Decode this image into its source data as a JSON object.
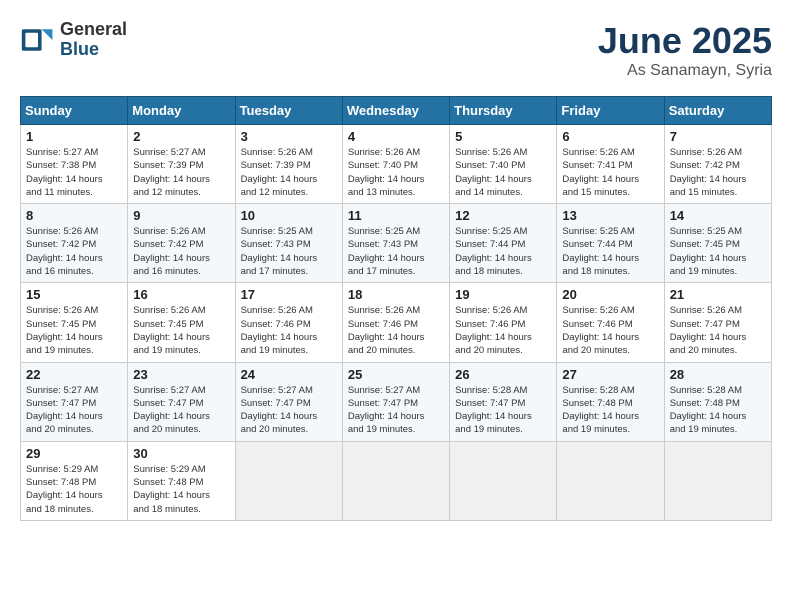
{
  "header": {
    "logo_general": "General",
    "logo_blue": "Blue",
    "month_title": "June 2025",
    "location": "As Sanamayn, Syria"
  },
  "weekdays": [
    "Sunday",
    "Monday",
    "Tuesday",
    "Wednesday",
    "Thursday",
    "Friday",
    "Saturday"
  ],
  "weeks": [
    [
      {
        "day": "1",
        "rise": "5:27 AM",
        "set": "7:38 PM",
        "daylight": "14 hours and 11 minutes."
      },
      {
        "day": "2",
        "rise": "5:27 AM",
        "set": "7:39 PM",
        "daylight": "14 hours and 12 minutes."
      },
      {
        "day": "3",
        "rise": "5:26 AM",
        "set": "7:39 PM",
        "daylight": "14 hours and 12 minutes."
      },
      {
        "day": "4",
        "rise": "5:26 AM",
        "set": "7:40 PM",
        "daylight": "14 hours and 13 minutes."
      },
      {
        "day": "5",
        "rise": "5:26 AM",
        "set": "7:40 PM",
        "daylight": "14 hours and 14 minutes."
      },
      {
        "day": "6",
        "rise": "5:26 AM",
        "set": "7:41 PM",
        "daylight": "14 hours and 15 minutes."
      },
      {
        "day": "7",
        "rise": "5:26 AM",
        "set": "7:42 PM",
        "daylight": "14 hours and 15 minutes."
      }
    ],
    [
      {
        "day": "8",
        "rise": "5:26 AM",
        "set": "7:42 PM",
        "daylight": "14 hours and 16 minutes."
      },
      {
        "day": "9",
        "rise": "5:26 AM",
        "set": "7:42 PM",
        "daylight": "14 hours and 16 minutes."
      },
      {
        "day": "10",
        "rise": "5:25 AM",
        "set": "7:43 PM",
        "daylight": "14 hours and 17 minutes."
      },
      {
        "day": "11",
        "rise": "5:25 AM",
        "set": "7:43 PM",
        "daylight": "14 hours and 17 minutes."
      },
      {
        "day": "12",
        "rise": "5:25 AM",
        "set": "7:44 PM",
        "daylight": "14 hours and 18 minutes."
      },
      {
        "day": "13",
        "rise": "5:25 AM",
        "set": "7:44 PM",
        "daylight": "14 hours and 18 minutes."
      },
      {
        "day": "14",
        "rise": "5:25 AM",
        "set": "7:45 PM",
        "daylight": "14 hours and 19 minutes."
      }
    ],
    [
      {
        "day": "15",
        "rise": "5:26 AM",
        "set": "7:45 PM",
        "daylight": "14 hours and 19 minutes."
      },
      {
        "day": "16",
        "rise": "5:26 AM",
        "set": "7:45 PM",
        "daylight": "14 hours and 19 minutes."
      },
      {
        "day": "17",
        "rise": "5:26 AM",
        "set": "7:46 PM",
        "daylight": "14 hours and 19 minutes."
      },
      {
        "day": "18",
        "rise": "5:26 AM",
        "set": "7:46 PM",
        "daylight": "14 hours and 20 minutes."
      },
      {
        "day": "19",
        "rise": "5:26 AM",
        "set": "7:46 PM",
        "daylight": "14 hours and 20 minutes."
      },
      {
        "day": "20",
        "rise": "5:26 AM",
        "set": "7:46 PM",
        "daylight": "14 hours and 20 minutes."
      },
      {
        "day": "21",
        "rise": "5:26 AM",
        "set": "7:47 PM",
        "daylight": "14 hours and 20 minutes."
      }
    ],
    [
      {
        "day": "22",
        "rise": "5:27 AM",
        "set": "7:47 PM",
        "daylight": "14 hours and 20 minutes."
      },
      {
        "day": "23",
        "rise": "5:27 AM",
        "set": "7:47 PM",
        "daylight": "14 hours and 20 minutes."
      },
      {
        "day": "24",
        "rise": "5:27 AM",
        "set": "7:47 PM",
        "daylight": "14 hours and 20 minutes."
      },
      {
        "day": "25",
        "rise": "5:27 AM",
        "set": "7:47 PM",
        "daylight": "14 hours and 19 minutes."
      },
      {
        "day": "26",
        "rise": "5:28 AM",
        "set": "7:47 PM",
        "daylight": "14 hours and 19 minutes."
      },
      {
        "day": "27",
        "rise": "5:28 AM",
        "set": "7:48 PM",
        "daylight": "14 hours and 19 minutes."
      },
      {
        "day": "28",
        "rise": "5:28 AM",
        "set": "7:48 PM",
        "daylight": "14 hours and 19 minutes."
      }
    ],
    [
      {
        "day": "29",
        "rise": "5:29 AM",
        "set": "7:48 PM",
        "daylight": "14 hours and 18 minutes."
      },
      {
        "day": "30",
        "rise": "5:29 AM",
        "set": "7:48 PM",
        "daylight": "14 hours and 18 minutes."
      },
      null,
      null,
      null,
      null,
      null
    ]
  ],
  "labels": {
    "sunrise": "Sunrise:",
    "sunset": "Sunset:",
    "daylight": "Daylight:"
  }
}
